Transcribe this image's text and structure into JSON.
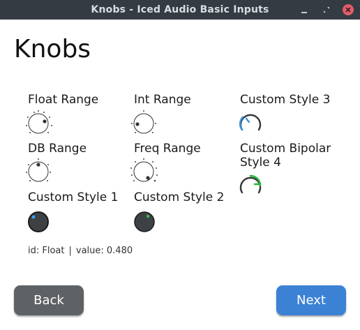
{
  "window": {
    "title": "Knobs - Iced Audio Basic Inputs",
    "controls": {
      "minimize_icon": "minimize-icon",
      "maximize_icon": "maximize-icon",
      "close_icon": "close-icon",
      "close_color": "#e35d6a"
    }
  },
  "page": {
    "title": "Knobs"
  },
  "knobs": {
    "float_range": {
      "label": "Float Range"
    },
    "int_range": {
      "label": "Int Range"
    },
    "custom_style_3": {
      "label": "Custom Style 3",
      "accent": "#3b8fd9"
    },
    "db_range": {
      "label": "DB Range"
    },
    "freq_range": {
      "label": "Freq Range"
    },
    "custom_bipolar_4": {
      "label_line1": "Custom Bipolar",
      "label_line2": "Style 4",
      "accent": "#27b53a"
    },
    "custom_style_1": {
      "label": "Custom Style 1",
      "dot_color": "#3aa0ff"
    },
    "custom_style_2": {
      "label": "Custom Style 2",
      "dot_color": "#2ecc40"
    }
  },
  "status": {
    "id_text": "id: Float",
    "separator": "|",
    "value_text": "value: 0.480"
  },
  "nav": {
    "back_label": "Back",
    "next_label": "Next"
  }
}
